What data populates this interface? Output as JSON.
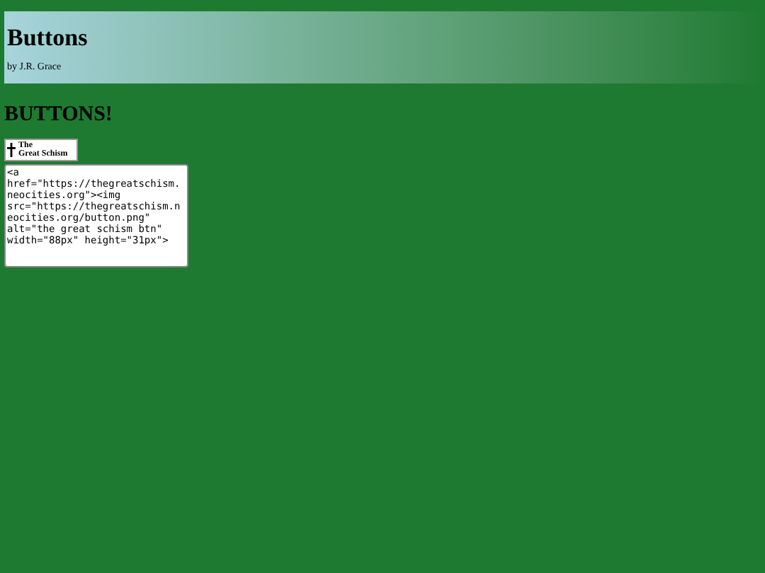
{
  "header": {
    "title": "Buttons",
    "byline": "by J.R. Grace"
  },
  "heading": "BUTTONS!",
  "button_banner": {
    "line_1": "The",
    "line_2": "Great Schism"
  },
  "code_box": {
    "value": "<a href=\"https://thegreatschism.neocities.org\"><img src=\"https://thegreatschism.neocities.org/button.png\" alt=\"the great schism btn\" width=\"88px\" height=\"31px\">"
  }
}
